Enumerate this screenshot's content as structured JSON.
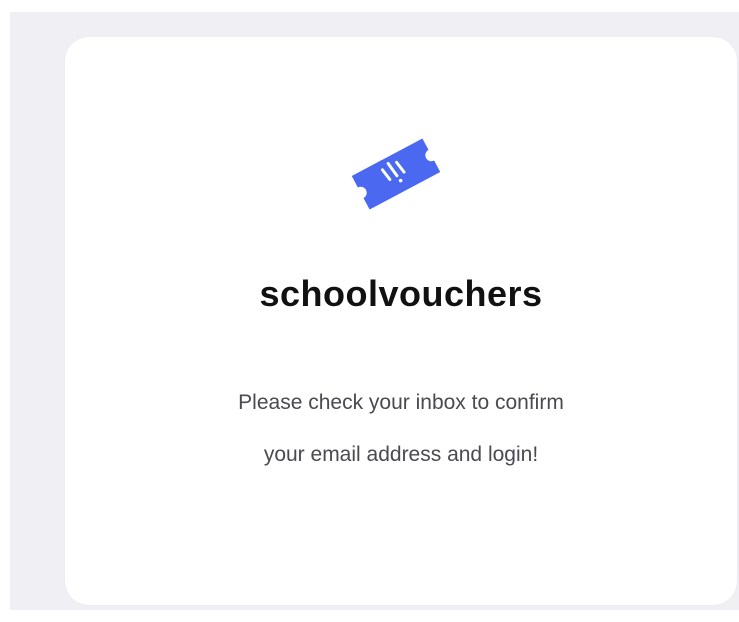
{
  "brand": {
    "name": "schoolvouchers",
    "icon": "ticket-icon",
    "accent_color": "#4a68f0"
  },
  "message": {
    "line1": "Please check your inbox to confirm",
    "line2": "your email address and login!"
  }
}
